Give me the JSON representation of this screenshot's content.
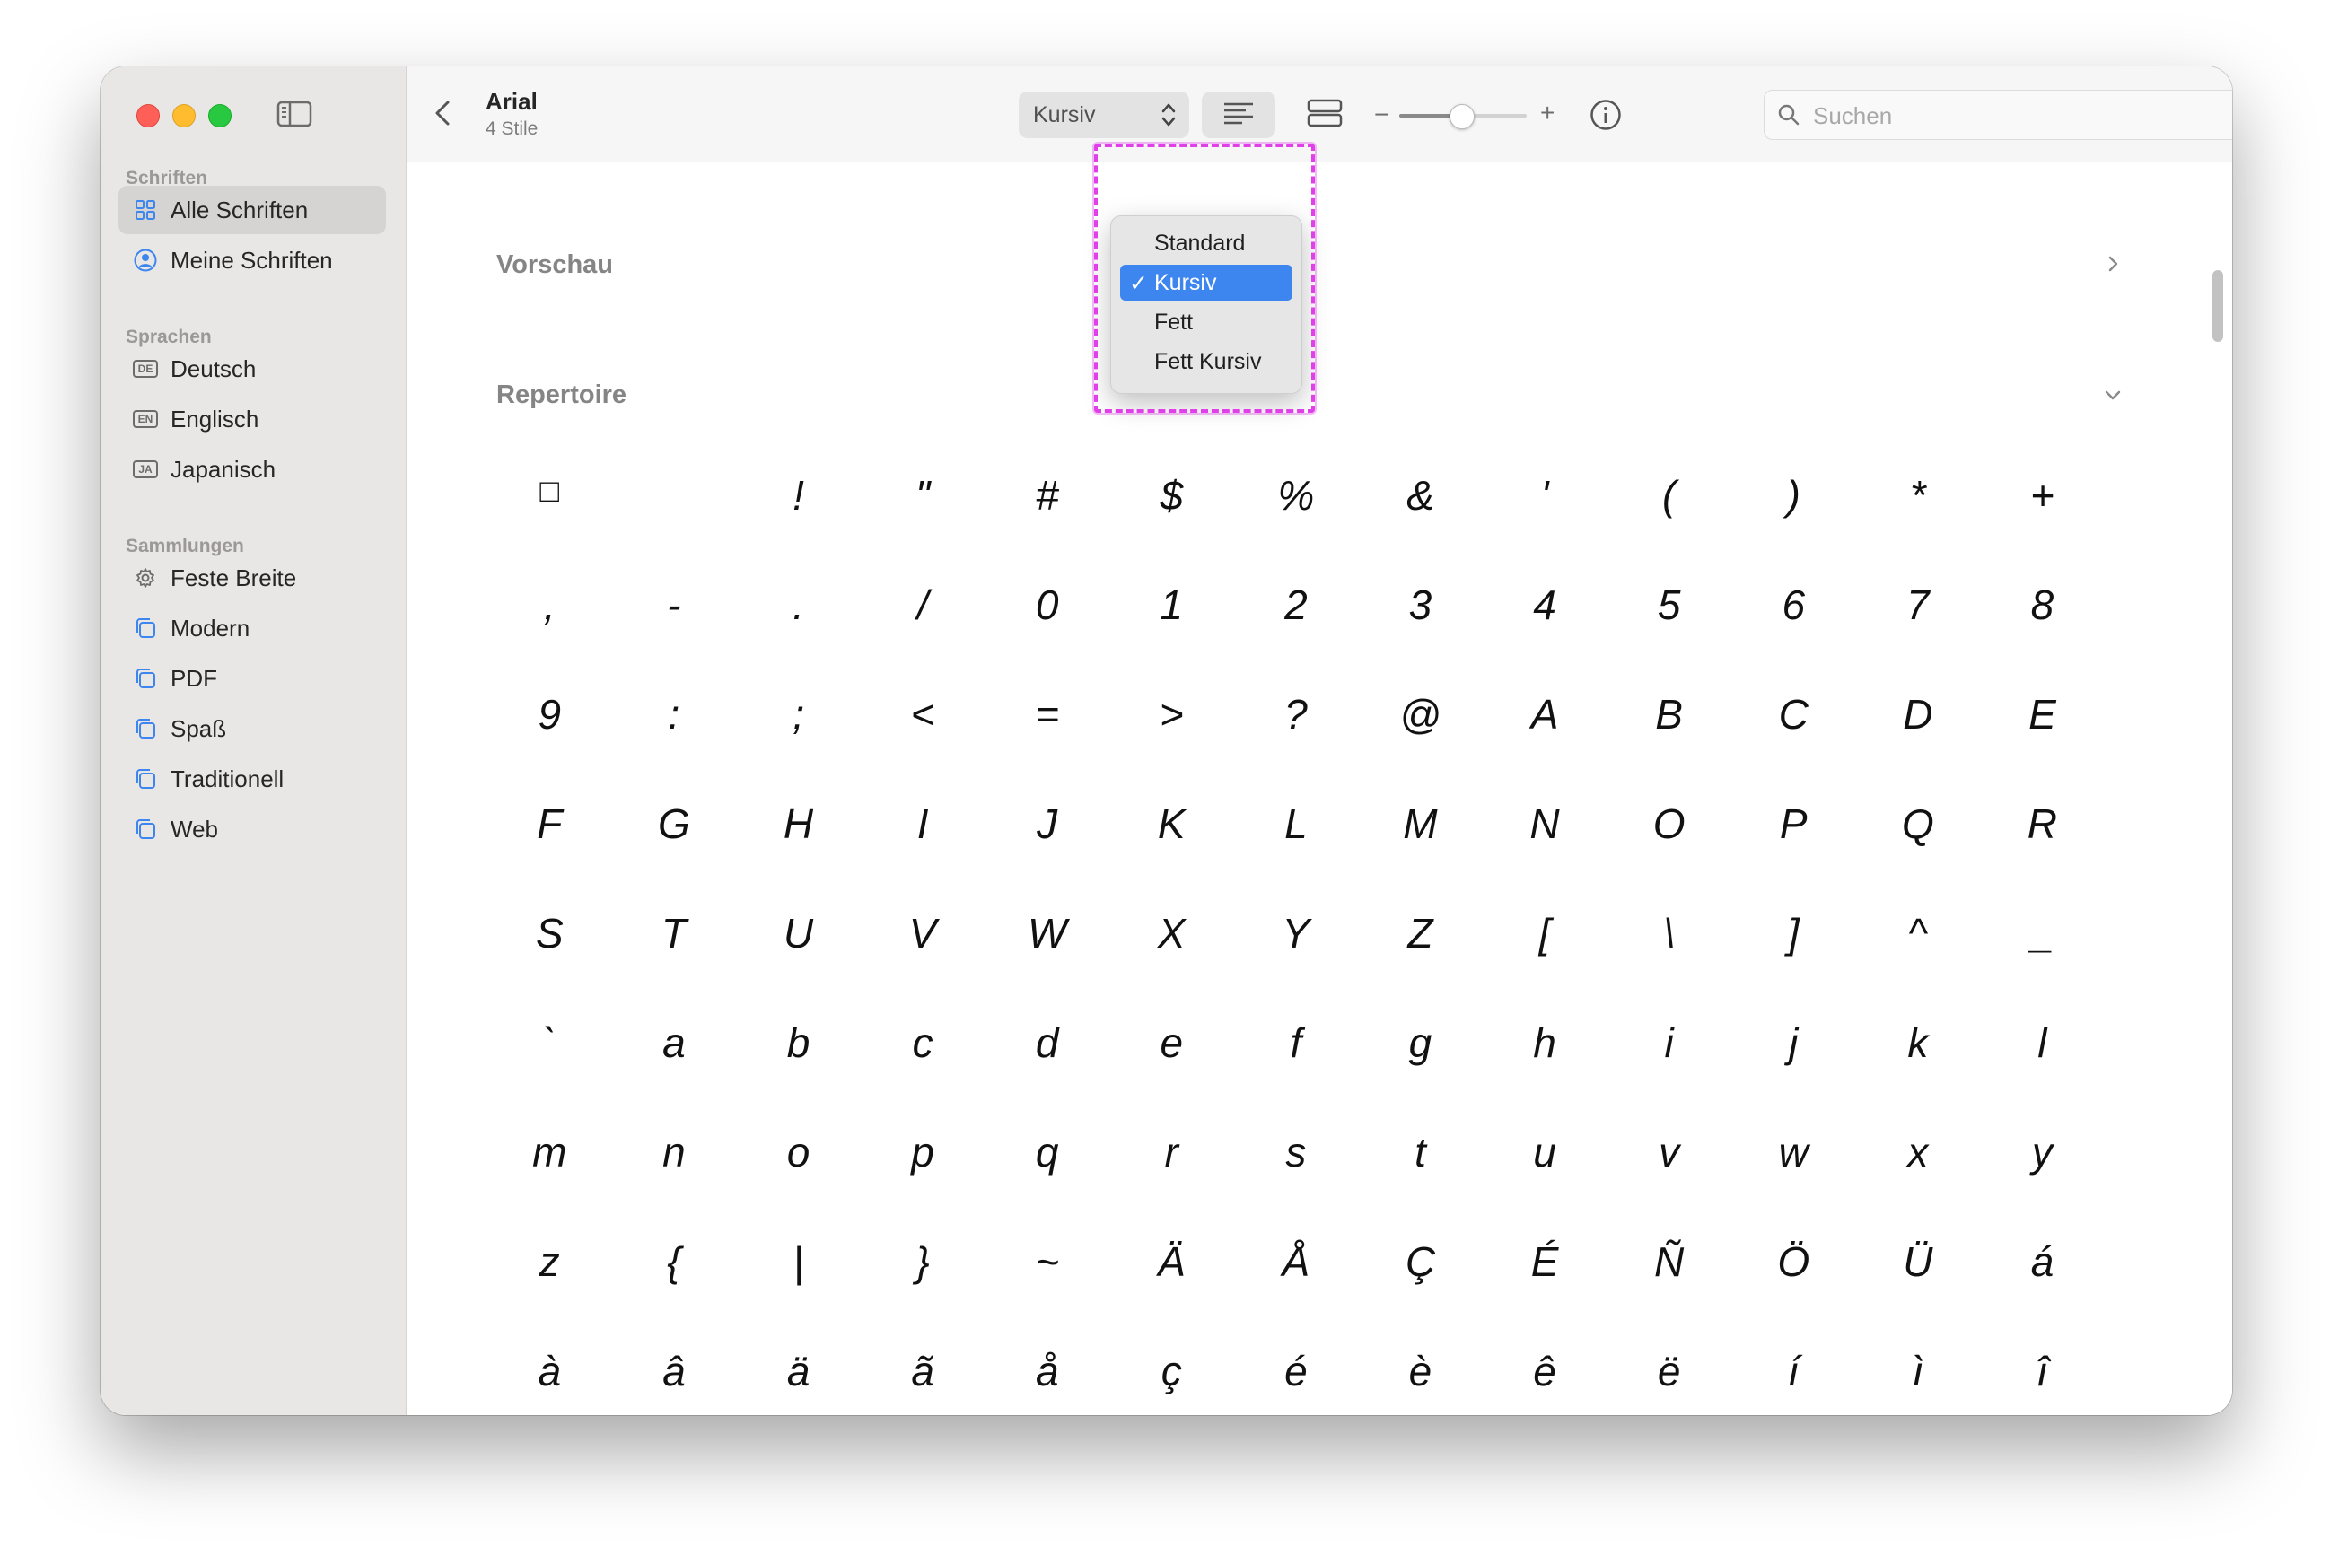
{
  "sidebar": {
    "sections": [
      {
        "title": "Schriften",
        "items": [
          {
            "label": "Alle Schriften",
            "icon": "grid-icon"
          },
          {
            "label": "Meine Schriften",
            "icon": "person-circle-icon"
          }
        ]
      },
      {
        "title": "Sprachen",
        "items": [
          {
            "label": "Deutsch",
            "badge": "DE"
          },
          {
            "label": "Englisch",
            "badge": "EN"
          },
          {
            "label": "Japanisch",
            "badge": "JA"
          }
        ]
      },
      {
        "title": "Sammlungen",
        "items": [
          {
            "label": "Feste Breite",
            "icon": "gear-icon"
          },
          {
            "label": "Modern",
            "icon": "collection-icon"
          },
          {
            "label": "PDF",
            "icon": "collection-icon"
          },
          {
            "label": "Spaß",
            "icon": "collection-icon"
          },
          {
            "label": "Traditionell",
            "icon": "collection-icon"
          },
          {
            "label": "Web",
            "icon": "collection-icon"
          }
        ]
      }
    ]
  },
  "toolbar": {
    "font_name": "Arial",
    "style_count": "4 Stile",
    "style_select_value": "Kursiv",
    "search_placeholder": "Suchen"
  },
  "style_menu": {
    "options": [
      "Standard",
      "Kursiv",
      "Fett",
      "Fett Kursiv"
    ],
    "selected": "Kursiv",
    "check": "✓"
  },
  "content": {
    "preview_title": "Vorschau",
    "repertoire_title": "Repertoire",
    "glyph_rows": [
      [
        "□",
        " ",
        "!",
        "\"",
        "#",
        "$",
        "%",
        "&",
        "'",
        "(",
        ")",
        "*",
        "+"
      ],
      [
        ",",
        "-",
        ".",
        "/",
        "0",
        "1",
        "2",
        "3",
        "4",
        "5",
        "6",
        "7",
        "8"
      ],
      [
        "9",
        ":",
        ";",
        "<",
        "=",
        ">",
        "?",
        "@",
        "A",
        "B",
        "C",
        "D",
        "E"
      ],
      [
        "F",
        "G",
        "H",
        "I",
        "J",
        "K",
        "L",
        "M",
        "N",
        "O",
        "P",
        "Q",
        "R"
      ],
      [
        "S",
        "T",
        "U",
        "V",
        "W",
        "X",
        "Y",
        "Z",
        "[",
        "\\",
        "]",
        "^",
        "_"
      ],
      [
        "`",
        "a",
        "b",
        "c",
        "d",
        "e",
        "f",
        "g",
        "h",
        "i",
        "j",
        "k",
        "l"
      ],
      [
        "m",
        "n",
        "o",
        "p",
        "q",
        "r",
        "s",
        "t",
        "u",
        "v",
        "w",
        "x",
        "y"
      ],
      [
        "z",
        "{",
        "|",
        "}",
        "~",
        "Ä",
        "Å",
        "Ç",
        "É",
        "Ñ",
        "Ö",
        "Ü",
        "á"
      ],
      [
        "à",
        "â",
        "ä",
        "ã",
        "å",
        "ç",
        "é",
        "è",
        "ê",
        "ë",
        "í",
        "ì",
        "î"
      ]
    ]
  },
  "colors": {
    "accent": "#3d85ef",
    "highlight": "#e040e8",
    "sidebar_bg": "#e9e7e6"
  }
}
